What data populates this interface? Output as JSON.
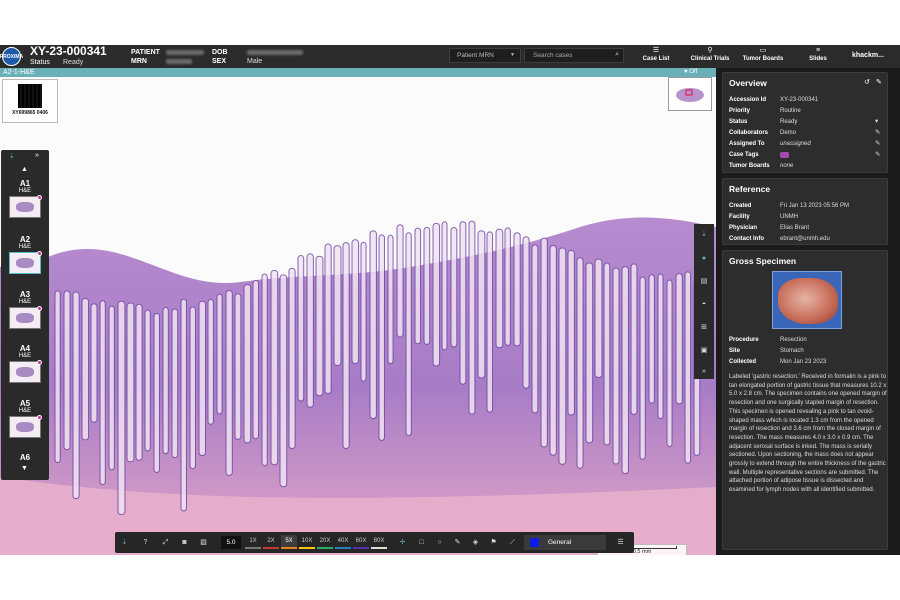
{
  "header": {
    "logo_text": "PROXIMA",
    "accession": "XY-23-000341",
    "status_label": "Status",
    "status_value": "Ready",
    "patient_label": "PATIENT",
    "mrn_label": "MRN",
    "dob_label": "DOB",
    "sex_label": "SEX",
    "sex_value": "Male",
    "mrn_select": "Patient MRN",
    "search_placeholder": "Search cases",
    "nav": [
      "Case List",
      "Clinical Trials",
      "Tumor Boards",
      "Slides"
    ],
    "user": "khackm..."
  },
  "slide_label": "A2-1-H&E",
  "off_badge": "Off",
  "barcode_text": "XY699865 0406",
  "tray": {
    "items": [
      {
        "name": "A1",
        "stain": "H&E"
      },
      {
        "name": "A2",
        "stain": "H&E"
      },
      {
        "name": "A3",
        "stain": "H&E"
      },
      {
        "name": "A4",
        "stain": "H&E"
      },
      {
        "name": "A5",
        "stain": "H&E"
      },
      {
        "name": "A6",
        "stain": ""
      }
    ]
  },
  "toolbar": {
    "zoom_value": "5.0",
    "zoom_levels": [
      "1X",
      "2X",
      "5X",
      "10X",
      "20X",
      "40X",
      "60X",
      "80X"
    ],
    "active_zoom": "5X",
    "annotation_layer": "General",
    "annotation_color": "#0a1ee6"
  },
  "scalebar": "0.5 mm",
  "overview": {
    "title": "Overview",
    "rows": [
      {
        "k": "Accession Id",
        "v": "XY-23-000341"
      },
      {
        "k": "Priority",
        "v": "Routine"
      },
      {
        "k": "Status",
        "v": "Ready"
      },
      {
        "k": "Collaborators",
        "v": "Demo"
      },
      {
        "k": "Assigned To",
        "v": "unassigned"
      },
      {
        "k": "Case Tags",
        "v": ""
      },
      {
        "k": "Tumor Boards",
        "v": "none"
      }
    ]
  },
  "reference": {
    "title": "Reference",
    "rows": [
      {
        "k": "Created",
        "v": "Fri Jan 13 2023 05:56 PM"
      },
      {
        "k": "Facility",
        "v": "UNMH"
      },
      {
        "k": "Physician",
        "v": "Elias Brant"
      },
      {
        "k": "Contact Info",
        "v": "ebrant@unmh.edu"
      }
    ]
  },
  "gross": {
    "title": "Gross Specimen",
    "rows": [
      {
        "k": "Procedure",
        "v": "Resection"
      },
      {
        "k": "Site",
        "v": "Stomach"
      },
      {
        "k": "Collected",
        "v": "Mon Jan 23 2023"
      }
    ],
    "description": "Labeled 'gastric resection.' Received in formalin is a pink to tan elongated portion of gastric tissue that measures 10.2 x 5.0 x 2.8 cm. The specimen contains one opened margin of resection and one surgically stapled margin of resection. This specimen is opened revealing a pink to tan ovoid-shaped mass which is located 1.3 cm from the opened margin of resection and 3.6 cm from the closed margin of resection. The mass measures 4.0 x 3.0 x 0.9 cm. The adjacent serosal surface is inked. The mass is serially sectioned. Upon sectioning, the mass does not appear grossly to extend through the entire thickness of the gastric wall. Multiple representative sections are submitted. The attached portion of adipose tissue is dissected and examined for lymph nodes with all identified submitted."
  }
}
